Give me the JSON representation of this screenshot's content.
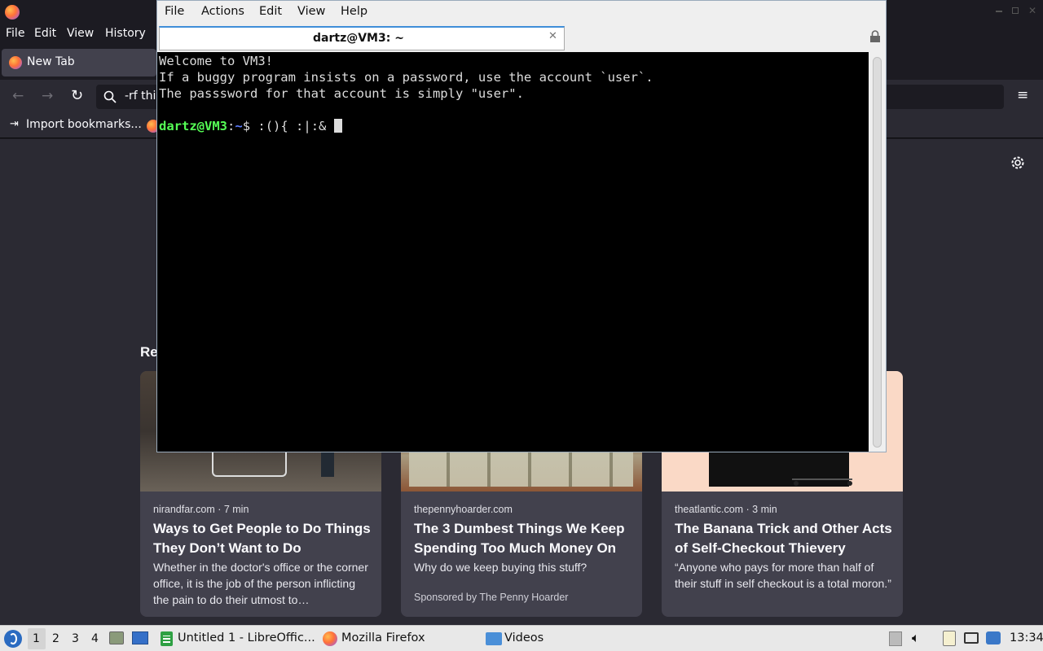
{
  "firefox": {
    "menu": [
      "File",
      "Edit",
      "View",
      "History"
    ],
    "tab_title": "New Tab",
    "url_text": "-rf thi",
    "bookmark_import": "Import bookmarks...",
    "section_heading": "Re",
    "cards": [
      {
        "source": "nirandfar.com · 7 min",
        "title": "Ways to Get People to Do Things They Don’t Want to Do",
        "description": "Whether in the doctor's office or the corner office, it is the job of the person inflicting the pain to do their utmost to…",
        "sponsor": ""
      },
      {
        "source": "thepennyhoarder.com",
        "title": "The 3 Dumbest Things We Keep Spending Too Much Money On",
        "description": "Why do we keep buying this stuff?",
        "sponsor": "Sponsored by The Penny Hoarder"
      },
      {
        "source": "theatlantic.com · 3 min",
        "title": "The Banana Trick and Other Acts of Self-Checkout Thievery",
        "description": "“Anyone who pays for more than half of their stuff in self checkout is a total moron.”",
        "sponsor": ""
      }
    ]
  },
  "terminal": {
    "menu": [
      "File",
      "Actions",
      "Edit",
      "View",
      "Help"
    ],
    "tab_title": "dartz@VM3: ~",
    "lines": [
      "Welcome to VM3!",
      "If a buggy program insists on a password, use the account `user`.",
      "The passsword for that account is simply \"user\"."
    ],
    "prompt_user": "dartz@VM3",
    "prompt_sep": ":",
    "prompt_path": "~",
    "prompt_dollar": "$",
    "command": ":(){ :|:& "
  },
  "taskbar": {
    "workspaces": [
      "1",
      "2",
      "3",
      "4"
    ],
    "tasks": [
      {
        "label": "Untitled 1 - LibreOffic...",
        "icon": "libreoffice-calc-icon"
      },
      {
        "label": "Mozilla Firefox",
        "icon": "firefox-icon"
      },
      {
        "label": "Videos",
        "icon": "folder-icon"
      }
    ],
    "clock": "13:34"
  },
  "colors": {
    "prompt_green": "#55ff55",
    "prompt_blue": "#5c7cff",
    "terminal_bg": "#000000",
    "firefox_dark": "#1c1b22",
    "accent_blue": "#3f8ed8"
  }
}
